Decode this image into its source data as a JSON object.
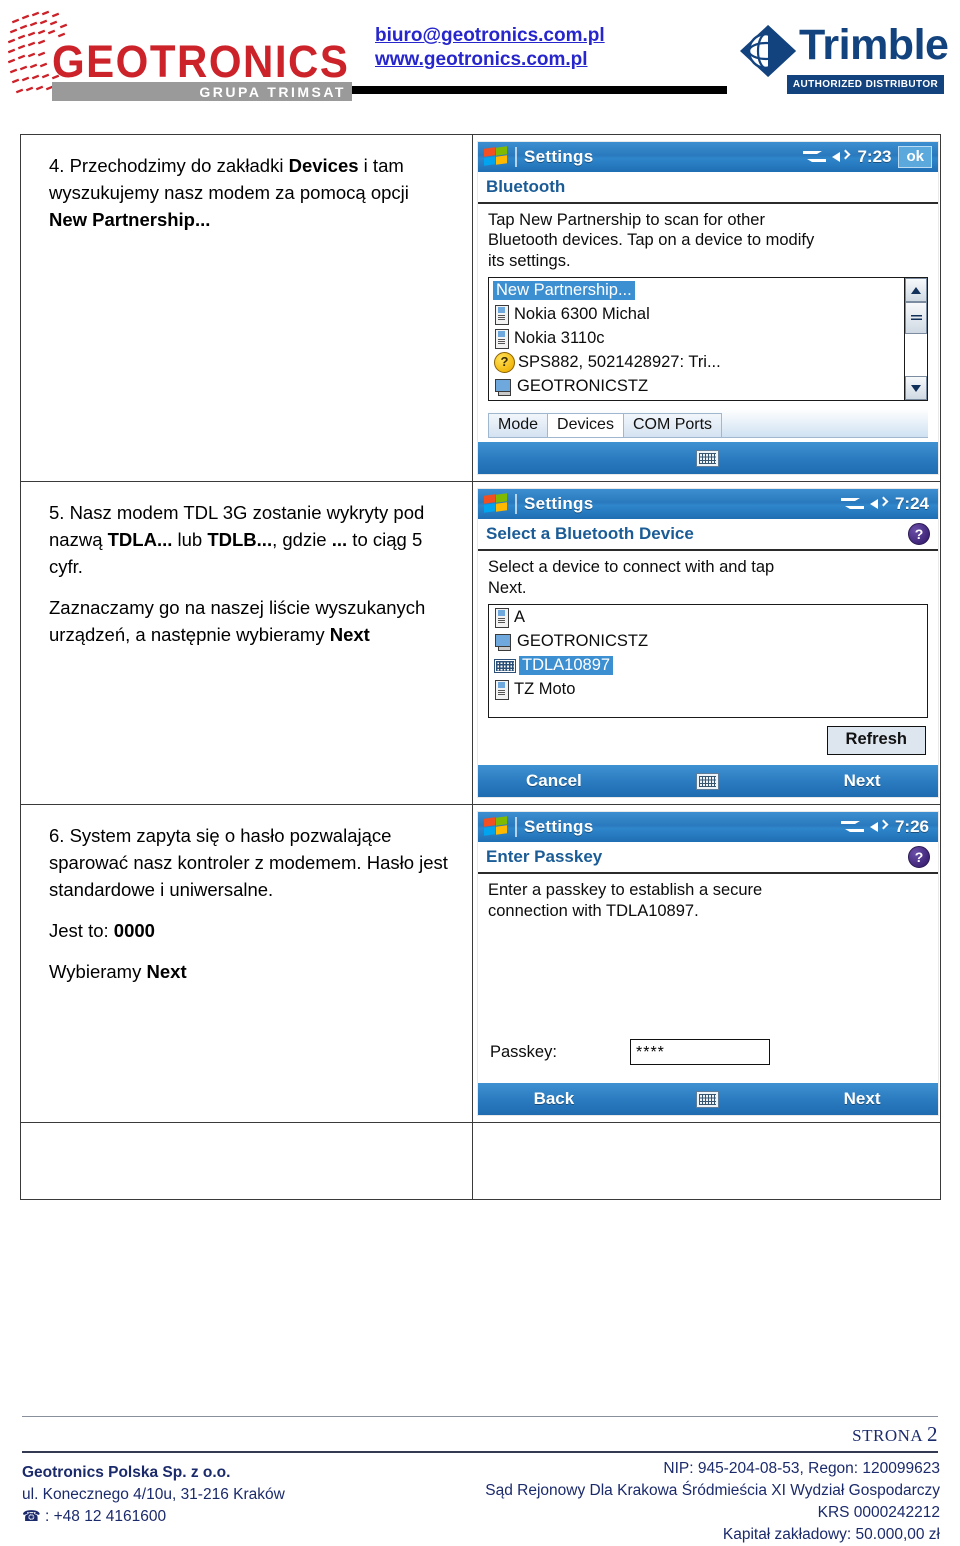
{
  "header": {
    "logo_primary_word": "GEOTRONICS",
    "logo_primary_sub": "GRUPA TRIMSAT",
    "email": "biuro@geotronics.com.pl",
    "website": "www.geotronics.com.pl",
    "logo_secondary_word": "Trimble",
    "logo_secondary_sub": "AUTHORIZED DISTRIBUTOR"
  },
  "steps": [
    {
      "number": "4.",
      "paragraphs": [
        "4. Przechodzimy do zakładki Devices i tam wyszukujemy nasz modem za pomocą opcji New Partnership..."
      ]
    },
    {
      "number": "5.",
      "paragraphs": [
        "5. Nasz modem TDL 3G zostanie wykryty pod nazwą TDLA... lub TDLB..., gdzie ... to ciąg 5 cyfr.",
        "Zaznaczamy go na naszej liście wyszukanych urządzeń, a następnie wybieramy Next"
      ]
    },
    {
      "number": "6.",
      "paragraphs": [
        "6. System zapyta się o hasło pozwalające sparować nasz kontroler z modemem. Hasło jest standardowe i uniwersalne.",
        "Jest to: 0000",
        "Wybieramy Next"
      ]
    }
  ],
  "shot1": {
    "title": "Settings",
    "clock": "7:23",
    "ok_label": "ok",
    "subhead": "Bluetooth",
    "instruction": "Tap New Partnership to scan for other\nBluetooth devices. Tap on a device to modify\nits settings.",
    "devices": [
      {
        "label": "New Partnership...",
        "icon": "none",
        "selected": true
      },
      {
        "label": "Nokia 6300 Michal",
        "icon": "phone-icon",
        "selected": false
      },
      {
        "label": "Nokia 3110c",
        "icon": "phone-icon",
        "selected": false
      },
      {
        "label": "SPS882, 5021428927: Tri...",
        "icon": "question-icon",
        "selected": false
      },
      {
        "label": "GEOTRONICSTZ",
        "icon": "computer-icon",
        "selected": false
      }
    ],
    "tabs": [
      {
        "label": "Mode",
        "active": false
      },
      {
        "label": "Devices",
        "active": true
      },
      {
        "label": "COM Ports",
        "active": false
      }
    ]
  },
  "shot2": {
    "title": "Settings",
    "clock": "7:24",
    "subhead": "Select a Bluetooth Device",
    "help_label": "?",
    "instruction": "Select a device to connect with and tap\nNext.",
    "devices": [
      {
        "label": "A",
        "icon": "phone-icon",
        "selected": false
      },
      {
        "label": "GEOTRONICSTZ",
        "icon": "computer-icon",
        "selected": false
      },
      {
        "label": "TDLA10897",
        "icon": "modem-icon",
        "selected": true
      },
      {
        "label": "TZ Moto",
        "icon": "phone-icon",
        "selected": false
      }
    ],
    "refresh_label": "Refresh",
    "cmd_left": "Cancel",
    "cmd_right": "Next"
  },
  "shot3": {
    "title": "Settings",
    "clock": "7:26",
    "subhead": "Enter Passkey",
    "help_label": "?",
    "instruction": "Enter a passkey to establish a secure\nconnection with TDLA10897.",
    "passkey_label": "Passkey:",
    "passkey_value": "****",
    "cmd_left": "Back",
    "cmd_right": "Next"
  },
  "footer": {
    "page_word": "STRONA",
    "page_number": "2",
    "company": "Geotronics Polska Sp. z o.o.",
    "address": "ul. Konecznego 4/10u, 31-216 Kraków",
    "phone": ": +48 12 4161600",
    "legal": [
      "NIP: 945-204-08-53, Regon: 120099623",
      "Sąd Rejonowy Dla Krakowa Śródmieścia XI Wydział Gospodarczy",
      "KRS 0000242212",
      "Kapitał zakładowy: 50.000,00 zł"
    ]
  },
  "colors": {
    "brand_red": "#cc2229",
    "brand_blue": "#13437e",
    "link_blue": "#2626cc",
    "footer_navy": "#1b2a6b",
    "ppc_title_blue": "#2a79be",
    "ppc_select_blue": "#3c8fd0"
  }
}
